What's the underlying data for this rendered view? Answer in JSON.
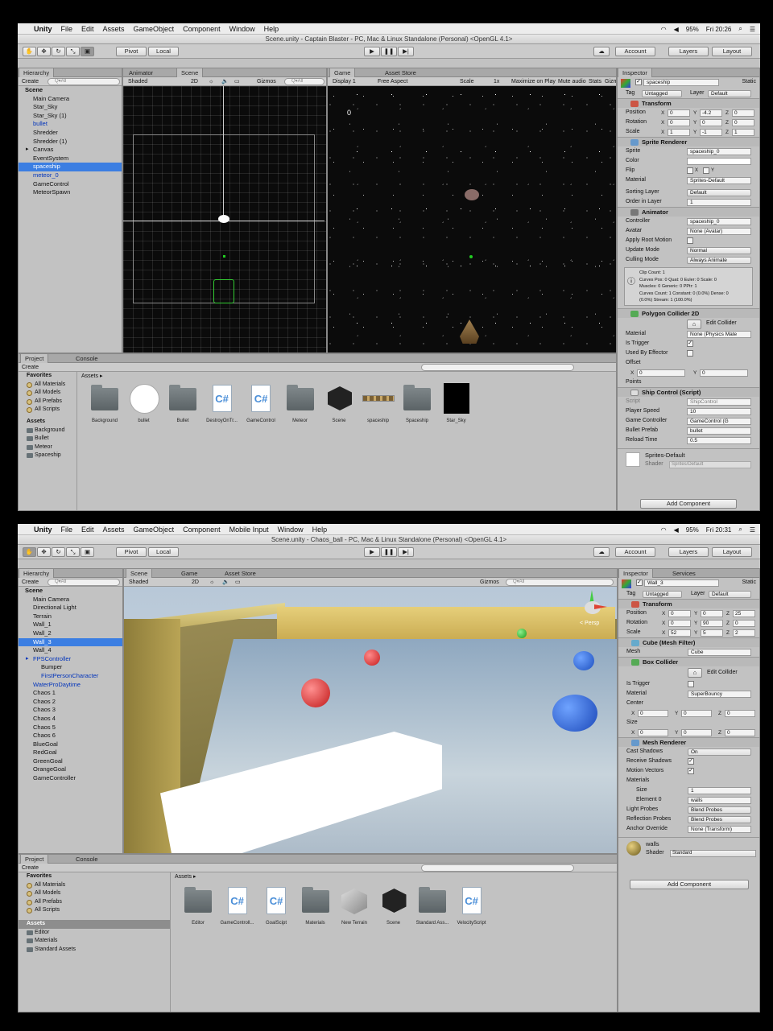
{
  "menubar1": {
    "app": "Unity",
    "items": [
      "File",
      "Edit",
      "Assets",
      "GameObject",
      "Component",
      "Window",
      "Help"
    ],
    "battery": "95%",
    "time": "Fri 20:26"
  },
  "menubar2": {
    "app": "Unity",
    "items": [
      "File",
      "Edit",
      "Assets",
      "GameObject",
      "Component",
      "Mobile Input",
      "Window",
      "Help"
    ],
    "battery": "95%",
    "time": "Fri 20:31"
  },
  "win1": {
    "title": "Scene.unity - Captain Blaster - PC, Mac & Linux Standalone (Personal) <OpenGL 4.1>",
    "toolbar": {
      "pivot": "Pivot",
      "local": "Local",
      "account": "Account",
      "layers": "Layers",
      "layout": "Layout"
    },
    "hierarchy": {
      "tab": "Hierarchy",
      "create": "Create",
      "search": "Q▾All",
      "scene": "Scene",
      "items": [
        {
          "label": "Main Camera",
          "style": ""
        },
        {
          "label": "Star_Sky",
          "style": ""
        },
        {
          "label": "Star_Sky (1)",
          "style": ""
        },
        {
          "label": "bullet",
          "style": "blue"
        },
        {
          "label": "Shredder",
          "style": ""
        },
        {
          "label": "Shredder (1)",
          "style": ""
        },
        {
          "label": "Canvas",
          "style": "arrow"
        },
        {
          "label": "EventSystem",
          "style": ""
        },
        {
          "label": "spaceship",
          "style": "sel"
        },
        {
          "label": "meteor_0",
          "style": "blue"
        },
        {
          "label": "GameControl",
          "style": ""
        },
        {
          "label": "MeteorSpawn",
          "style": ""
        }
      ]
    },
    "scene": {
      "tab_animator": "Animator",
      "tab_scene": "Scene",
      "shaded": "Shaded",
      "mode2d": "2D",
      "gizmos": "Gizmos",
      "search": "Q▾All"
    },
    "game": {
      "tab_game": "Game",
      "tab_store": "Asset Store",
      "display": "Display 1",
      "aspect": "Free Aspect",
      "scale_label": "Scale",
      "scale_val": "1x",
      "maximize": "Maximize on Play",
      "mute": "Mute audio",
      "stats": "Stats",
      "gizmos": "Gizm",
      "score": "0"
    },
    "project": {
      "tab_project": "Project",
      "tab_console": "Console",
      "create": "Create",
      "breadcrumb": "Assets ▸",
      "favorites": "Favorites",
      "fav_items": [
        "All Materials",
        "All Models",
        "All Prefabs",
        "All Scripts"
      ],
      "assets_root": "Assets",
      "folders": [
        "Background",
        "Bullet",
        "Meteor",
        "Spaceship"
      ],
      "assets": [
        {
          "name": "Background",
          "type": "folder"
        },
        {
          "name": "bullet",
          "type": "circle"
        },
        {
          "name": "Bullet",
          "type": "folder"
        },
        {
          "name": "DestroyOnTr...",
          "type": "cs"
        },
        {
          "name": "GameControl",
          "type": "cs"
        },
        {
          "name": "Meteor",
          "type": "folder"
        },
        {
          "name": "Scene",
          "type": "unity"
        },
        {
          "name": "spaceship",
          "type": "sprite"
        },
        {
          "name": "Spaceship",
          "type": "folder"
        },
        {
          "name": "Star_Sky",
          "type": "black"
        }
      ]
    },
    "inspector": {
      "tab": "Inspector",
      "name": "spaceship",
      "static": "Static",
      "tag_label": "Tag",
      "tag": "Untagged",
      "layer_label": "Layer",
      "layer": "Default",
      "transform": {
        "title": "Transform",
        "pos": [
          "0",
          "-4.2",
          "0"
        ],
        "rot": [
          "0",
          "0",
          "0"
        ],
        "scale": [
          "1",
          "-1",
          "1"
        ]
      },
      "sprite_renderer": {
        "title": "Sprite Renderer",
        "sprite": "spaceship_0",
        "color": "",
        "flip_x": "X",
        "flip_y": "Y",
        "material": "Sprites-Default",
        "sorting_layer": "Default",
        "order": "1"
      },
      "animator": {
        "title": "Animator",
        "controller": "spaceship_0",
        "avatar": "None (Avatar)",
        "update": "Normal",
        "culling": "Always Animate",
        "info": [
          "Clip Count: 1",
          "Curves Pos: 0 Quat: 0 Euler: 0 Scale: 0",
          "Muscles: 0 Generic: 0 PPtr: 1",
          "Curves Count: 1 Constant: 0 (0.0%) Dense: 0",
          "(0.0%) Stream: 1 (100.0%)"
        ]
      },
      "polygon": {
        "title": "Polygon Collider 2D",
        "edit": "Edit Collider",
        "material": "None (Physics Mate",
        "offset_x": "0",
        "offset_y": "0",
        "points": "Points"
      },
      "ship": {
        "title": "Ship Control (Script)",
        "script": "ShipControl",
        "speed": "10",
        "controller": "GameControl (G",
        "prefab": "bullet",
        "reload": "0.5"
      },
      "material_name": "Sprites-Default",
      "shader_label": "Shader",
      "shader": "Sprites/Default",
      "add": "Add Component"
    }
  },
  "win2": {
    "title": "Scene.unity - Chaos_ball - PC, Mac & Linux Standalone (Personal) <OpenGL 4.1>",
    "toolbar": {
      "pivot": "Pivot",
      "local": "Local",
      "account": "Account",
      "layers": "Layers",
      "layout": "Layout"
    },
    "hierarchy": {
      "tab": "Hierarchy",
      "create": "Create",
      "search": "Q▾All",
      "scene": "Scene",
      "items": [
        {
          "label": "Main Camera",
          "style": ""
        },
        {
          "label": "Directional Light",
          "style": ""
        },
        {
          "label": "Terrain",
          "style": ""
        },
        {
          "label": "Wall_1",
          "style": ""
        },
        {
          "label": "Wall_2",
          "style": ""
        },
        {
          "label": "Wall_3",
          "style": "sel"
        },
        {
          "label": "Wall_4",
          "style": ""
        },
        {
          "label": "FPSController",
          "style": "blue arrow"
        },
        {
          "label": "Bumper",
          "style": "ind"
        },
        {
          "label": "FirstPersonCharacter",
          "style": "blue ind"
        },
        {
          "label": "WaterProDaytime",
          "style": "blue"
        },
        {
          "label": "Chaos 1",
          "style": ""
        },
        {
          "label": "Chaos 2",
          "style": ""
        },
        {
          "label": "Chaos 3",
          "style": ""
        },
        {
          "label": "Chaos 4",
          "style": ""
        },
        {
          "label": "Chaos 5",
          "style": ""
        },
        {
          "label": "Chaos 6",
          "style": ""
        },
        {
          "label": "BlueGoal",
          "style": ""
        },
        {
          "label": "RedGoal",
          "style": ""
        },
        {
          "label": "GreenGoal",
          "style": ""
        },
        {
          "label": "OrangeGoal",
          "style": ""
        },
        {
          "label": "GameController",
          "style": ""
        }
      ]
    },
    "scene": {
      "tab_scene": "Scene",
      "tab_game": "Game",
      "tab_store": "Asset Store",
      "shaded": "Shaded",
      "mode2d": "2D",
      "gizmos": "Gizmos",
      "search": "Q▾All",
      "persp": "< Persp"
    },
    "project": {
      "tab_project": "Project",
      "tab_console": "Console",
      "create": "Create",
      "breadcrumb": "Assets ▸",
      "favorites": "Favorites",
      "fav_items": [
        "All Materials",
        "All Models",
        "All Prefabs",
        "All Scripts"
      ],
      "assets_root": "Assets",
      "folders": [
        "Editor",
        "Materials",
        "Standard Assets"
      ],
      "assets": [
        {
          "name": "Editor",
          "type": "folder"
        },
        {
          "name": "GameControll...",
          "type": "cs"
        },
        {
          "name": "GoalScipt",
          "type": "cs"
        },
        {
          "name": "Materials",
          "type": "folder"
        },
        {
          "name": "New Terrain",
          "type": "terrain"
        },
        {
          "name": "Scene",
          "type": "unity"
        },
        {
          "name": "Standard Ass...",
          "type": "folder"
        },
        {
          "name": "VelocityScript",
          "type": "cs"
        }
      ]
    },
    "inspector": {
      "tab": "Inspector",
      "tab2": "Services",
      "name": "Wall_3",
      "static": "Static",
      "tag_label": "Tag",
      "tag": "Untagged",
      "layer_label": "Layer",
      "layer": "Default",
      "transform": {
        "title": "Transform",
        "pos": [
          "0",
          "0",
          "25"
        ],
        "rot": [
          "0",
          "90",
          "0"
        ],
        "scale": [
          "52",
          "5",
          "2"
        ]
      },
      "mesh_filter": {
        "title": "Cube (Mesh Filter)",
        "mesh": "Cube"
      },
      "box": {
        "title": "Box Collider",
        "edit": "Edit Collider",
        "material": "SuperBouncy",
        "center": [
          "0",
          "0",
          "0"
        ],
        "size": [
          "0",
          "0",
          "0"
        ]
      },
      "mesh_renderer": {
        "title": "Mesh Renderer",
        "cast": "On",
        "materials": "Materials",
        "size": "1",
        "element0": "walls",
        "light": "Blend Probes",
        "refl": "Blend Probes",
        "anchor": "None (Transform)"
      },
      "material_name": "walls",
      "shader_label": "Shader",
      "shader": "Standard",
      "add": "Add Component"
    }
  }
}
